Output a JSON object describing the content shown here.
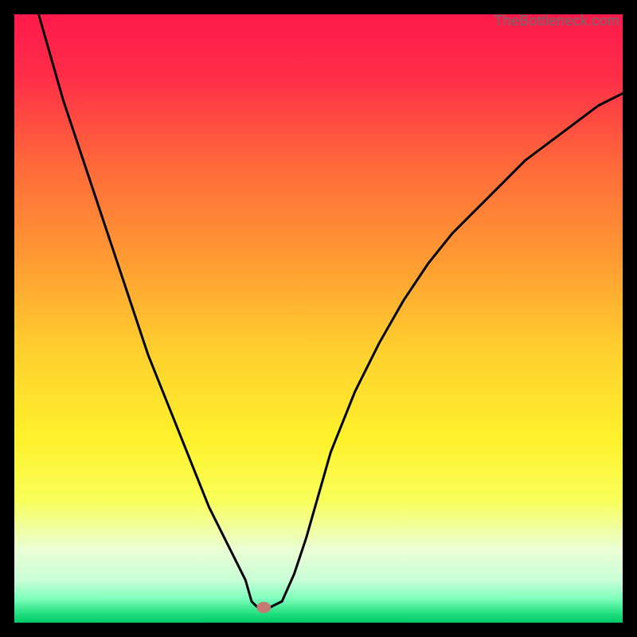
{
  "watermark": "TheBottleneck.com",
  "chart_data": {
    "type": "line",
    "title": "",
    "xlabel": "",
    "ylabel": "",
    "xlim": [
      0,
      100
    ],
    "ylim": [
      0,
      100
    ],
    "x": [
      4,
      6,
      8,
      10,
      12,
      14,
      16,
      18,
      20,
      22,
      24,
      26,
      28,
      30,
      32,
      34,
      36,
      38,
      39,
      40,
      42,
      44,
      46,
      48,
      50,
      52,
      56,
      60,
      64,
      68,
      72,
      76,
      80,
      84,
      88,
      92,
      96,
      100
    ],
    "y": [
      100,
      93,
      86,
      80,
      74,
      68,
      62,
      56,
      50,
      44,
      39,
      34,
      29,
      24,
      19,
      15,
      11,
      7,
      3.5,
      2.5,
      2.5,
      3.5,
      8,
      14,
      21,
      28,
      38,
      46,
      53,
      59,
      64,
      68,
      72,
      76,
      79,
      82,
      85,
      87
    ],
    "marker": {
      "x": 41,
      "y": 2.5
    },
    "background": "vertical-gradient",
    "gradient_stops": [
      {
        "pos": 0.0,
        "color": "#ff1a4b"
      },
      {
        "pos": 0.1,
        "color": "#ff2d48"
      },
      {
        "pos": 0.25,
        "color": "#ff6a3a"
      },
      {
        "pos": 0.4,
        "color": "#ff9a33"
      },
      {
        "pos": 0.55,
        "color": "#ffcf2e"
      },
      {
        "pos": 0.7,
        "color": "#fff22c"
      },
      {
        "pos": 0.8,
        "color": "#f8ff5a"
      },
      {
        "pos": 0.88,
        "color": "#eaffd5"
      },
      {
        "pos": 0.93,
        "color": "#c9ffd6"
      },
      {
        "pos": 0.96,
        "color": "#7fffbd"
      },
      {
        "pos": 0.985,
        "color": "#22e07e"
      },
      {
        "pos": 1.0,
        "color": "#00c96a"
      }
    ]
  }
}
